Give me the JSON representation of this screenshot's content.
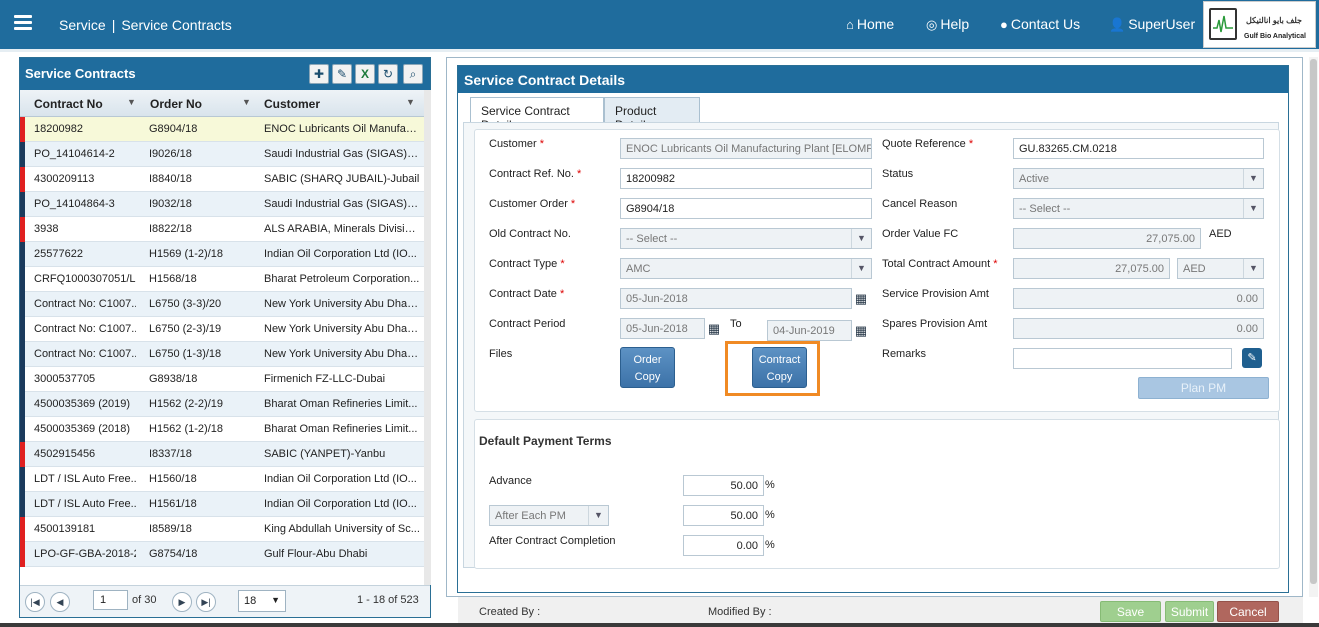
{
  "header": {
    "breadcrumb": [
      "Service",
      "Service Contracts"
    ],
    "nav": [
      {
        "label": "Home",
        "icon": "home-icon"
      },
      {
        "label": "Help",
        "icon": "lifebuoy-icon"
      },
      {
        "label": "Contact Us",
        "icon": "chat-bubble-icon"
      },
      {
        "label": "SuperUser",
        "icon": "user-icon"
      }
    ],
    "logo": {
      "arabic": "جلف بايو انالتيكل",
      "english": "Gulf Bio Analytical"
    },
    "colors": {
      "primary": "#1f6c9d",
      "highlight": "#f08a24"
    }
  },
  "list_panel": {
    "title": "Service Contracts",
    "tools": [
      "add-icon",
      "edit-icon",
      "excel-icon",
      "refresh-icon",
      "search-icon"
    ],
    "columns": [
      "Contract No",
      "Order No",
      "Customer"
    ],
    "rows": [
      {
        "contract": "18200982",
        "order": "G8904/18",
        "customer": "ENOC Lubricants Oil Manufact...",
        "flag": "#e02020"
      },
      {
        "contract": "PO_14104614-2",
        "order": "I9026/18",
        "customer": "Saudi Industrial Gas (SIGAS)-D...",
        "flag": "#1b3a5c"
      },
      {
        "contract": "4300209113",
        "order": "I8840/18",
        "customer": "SABIC (SHARQ JUBAIL)-Jubail",
        "flag": "#e02020"
      },
      {
        "contract": "PO_14104864-3",
        "order": "I9032/18",
        "customer": "Saudi Industrial Gas (SIGAS)-D...",
        "flag": "#1b3a5c"
      },
      {
        "contract": "3938",
        "order": "I8822/18",
        "customer": "ALS ARABIA, Minerals Division-...",
        "flag": "#e02020"
      },
      {
        "contract": "25577622",
        "order": "H1569 (1-2)/18",
        "customer": "Indian Oil Corporation Ltd (IO...",
        "flag": "#1b3a5c"
      },
      {
        "contract": "CRFQ1000307051/L...",
        "order": "H1568/18",
        "customer": "Bharat Petroleum Corporation...",
        "flag": "#1b3a5c"
      },
      {
        "contract": "Contract No: C1007...",
        "order": "L6750 (3-3)/20",
        "customer": "New York University Abu Dhab...",
        "flag": "#1b3a5c"
      },
      {
        "contract": "Contract No: C1007...",
        "order": "L6750 (2-3)/19",
        "customer": "New York University Abu Dhab...",
        "flag": "#1b3a5c"
      },
      {
        "contract": "Contract No: C1007...",
        "order": "L6750 (1-3)/18",
        "customer": "New York University Abu Dhab...",
        "flag": "#1b3a5c"
      },
      {
        "contract": "3000537705",
        "order": "G8938/18",
        "customer": "Firmenich FZ-LLC-Dubai",
        "flag": "#1b3a5c"
      },
      {
        "contract": "4500035369 (2019)",
        "order": "H1562 (2-2)/19",
        "customer": "Bharat Oman Refineries Limit...",
        "flag": "#1b3a5c"
      },
      {
        "contract": "4500035369 (2018)",
        "order": "H1562 (1-2)/18",
        "customer": "Bharat Oman Refineries Limit...",
        "flag": "#1b3a5c"
      },
      {
        "contract": "4502915456",
        "order": "I8337/18",
        "customer": "SABIC (YANPET)-Yanbu",
        "flag": "#e02020"
      },
      {
        "contract": "LDT / ISL Auto Free...",
        "order": "H1560/18",
        "customer": "Indian Oil Corporation Ltd (IO...",
        "flag": "#1b3a5c"
      },
      {
        "contract": "LDT / ISL Auto Free...",
        "order": "H1561/18",
        "customer": "Indian Oil Corporation Ltd (IO...",
        "flag": "#1b3a5c"
      },
      {
        "contract": "4500139181",
        "order": "I8589/18",
        "customer": "King Abdullah University of Sc...",
        "flag": "#e02020"
      },
      {
        "contract": "LPO-GF-GBA-2018-2...",
        "order": "G8754/18",
        "customer": "Gulf Flour-Abu Dhabi",
        "flag": "#e02020"
      }
    ],
    "pager": {
      "page": "1",
      "of": "of 30",
      "page_size": "18",
      "range": "1 - 18 of 523"
    }
  },
  "details": {
    "title": "Service Contract Details",
    "tabs": [
      "Service Contract Details",
      "Product Details"
    ],
    "labels": {
      "customer": "Customer",
      "contract_ref": "Contract Ref. No.",
      "customer_order": "Customer Order",
      "old_contract": "Old Contract No.",
      "contract_type": "Contract Type",
      "contract_date": "Contract Date",
      "contract_period": "Contract Period",
      "to": "To",
      "files": "Files",
      "quote_ref": "Quote Reference",
      "status": "Status",
      "cancel_reason": "Cancel Reason",
      "order_value": "Order Value FC",
      "total_amount": "Total Contract Amount",
      "service_provision": "Service Provision Amt",
      "spares_provision": "Spares Provision Amt",
      "remarks": "Remarks"
    },
    "values": {
      "customer": "ENOC Lubricants Oil Manufacturing Plant [ELOMP]-Du",
      "contract_ref": "18200982",
      "customer_order": "G8904/18",
      "old_contract": "-- Select --",
      "contract_type": "AMC",
      "contract_date": "05-Jun-2018",
      "period_from": "05-Jun-2018",
      "period_to": "04-Jun-2019",
      "quote_ref": "GU.83265.CM.0218",
      "status": "Active",
      "cancel_reason": "-- Select --",
      "order_value": "27,075.00",
      "order_currency": "AED",
      "total_amount": "27,075.00",
      "total_currency": "AED",
      "service_provision": "0.00",
      "spares_provision": "0.00",
      "remarks": ""
    },
    "buttons": {
      "order_copy": [
        "Order",
        "Copy"
      ],
      "contract_copy": [
        "Contract",
        "Copy"
      ],
      "plan_pm": "Plan PM"
    },
    "payment": {
      "title": "Default Payment Terms",
      "advance_label": "Advance",
      "advance": "50.00",
      "after_each_select": "After Each PM",
      "after_each": "50.00",
      "completion_label": "After Contract Completion",
      "completion": "0.00",
      "pct": "%"
    }
  },
  "footer": {
    "created_by": "Created By :",
    "modified_by": "Modified By :",
    "save": "Save",
    "submit": "Submit",
    "cancel": "Cancel"
  }
}
